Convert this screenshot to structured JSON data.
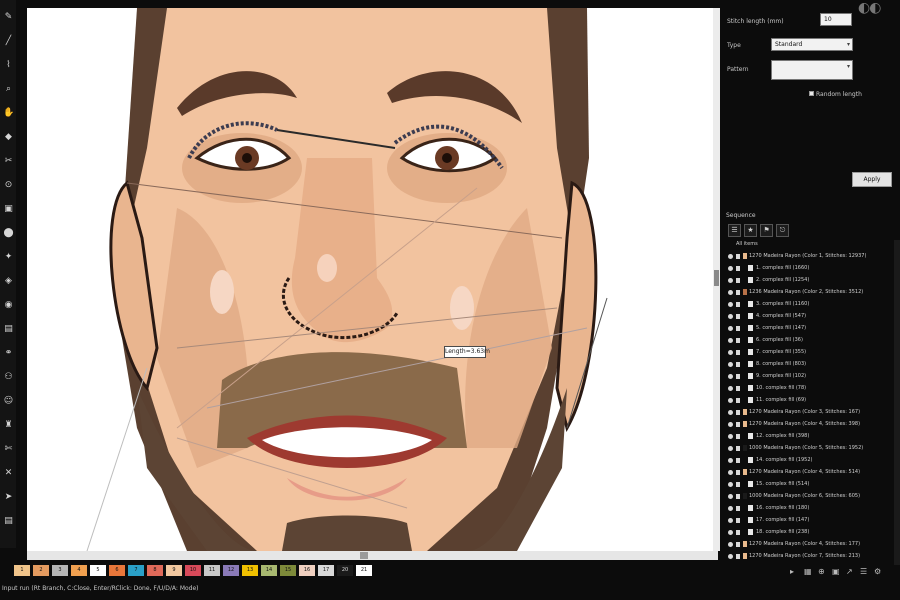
{
  "tools": [
    "pen-tool",
    "line-tool",
    "zigzag-tool",
    "zoom-tool",
    "hand-tool",
    "fill-tool",
    "knife-tool",
    "node-tool",
    "stamp-tool",
    "drop-tool",
    "pin-tool",
    "gauge-tool",
    "eye-tool",
    "grid-tool",
    "link-tool",
    "figure-tool",
    "person-tool",
    "lamp-tool",
    "cut-tool",
    "cross-tool",
    "arrow-tool",
    "file-tool"
  ],
  "canvas": {
    "tooltip": "Length=3.63m"
  },
  "stitch_panel": {
    "stitch_length_label": "Stitch length (mm)",
    "stitch_length_value": "10",
    "type_label": "Type",
    "type_value": "Standard",
    "pattern_label": "Pattern",
    "pattern_value": "",
    "random_length_label": "Random length",
    "apply_label": "Apply"
  },
  "sequence": {
    "header": "Sequence",
    "tabs": [
      "☰",
      "★",
      "⚑",
      "⎋"
    ],
    "rows": [
      {
        "text": "All items",
        "level": 0,
        "color": ""
      },
      {
        "text": "1270 Madeira Rayon (Color 1, Stitches: 12937)",
        "level": 1,
        "color": "#e8b98c"
      },
      {
        "text": "1. complex fill (1660)",
        "level": 2,
        "color": ""
      },
      {
        "text": "2. complex fill (1254)",
        "level": 2,
        "color": ""
      },
      {
        "text": "1236 Madeira Rayon (Color 2, Stitches: 3512)",
        "level": 1,
        "color": "#b87248"
      },
      {
        "text": "3. complex fill (1160)",
        "level": 2,
        "color": ""
      },
      {
        "text": "4. complex fill (547)",
        "level": 2,
        "color": ""
      },
      {
        "text": "5. complex fill (147)",
        "level": 2,
        "color": ""
      },
      {
        "text": "6. complex fill (36)",
        "level": 2,
        "color": ""
      },
      {
        "text": "7. complex fill (355)",
        "level": 2,
        "color": ""
      },
      {
        "text": "8. complex fill (803)",
        "level": 2,
        "color": ""
      },
      {
        "text": "9. complex fill (102)",
        "level": 2,
        "color": ""
      },
      {
        "text": "10. complex fill (78)",
        "level": 2,
        "color": ""
      },
      {
        "text": "11. complex fill (69)",
        "level": 2,
        "color": ""
      },
      {
        "text": "1270 Madeira Rayon (Color 3, Stitches: 167)",
        "level": 1,
        "color": "#e8b98c"
      },
      {
        "text": "1270 Madeira Rayon (Color 4, Stitches: 398)",
        "level": 1,
        "color": "#e8b98c"
      },
      {
        "text": "12. complex fill (398)",
        "level": 2,
        "color": ""
      },
      {
        "text": "1000 Madeira Rayon (Color 5, Stitches: 1952)",
        "level": 1,
        "color": "#1a1a1a"
      },
      {
        "text": "14. complex fill (1952)",
        "level": 2,
        "color": ""
      },
      {
        "text": "1270 Madeira Rayon (Color 4, Stitches: 514)",
        "level": 1,
        "color": "#e8b98c"
      },
      {
        "text": "15. complex fill (514)",
        "level": 2,
        "color": ""
      },
      {
        "text": "1000 Madeira Rayon (Color 6, Stitches: 605)",
        "level": 1,
        "color": "#1a1a1a"
      },
      {
        "text": "16. complex fill (180)",
        "level": 2,
        "color": ""
      },
      {
        "text": "17. complex fill (147)",
        "level": 2,
        "color": ""
      },
      {
        "text": "18. complex fill (238)",
        "level": 2,
        "color": ""
      },
      {
        "text": "1270 Madeira Rayon (Color 4, Stitches: 177)",
        "level": 1,
        "color": "#e8b98c"
      },
      {
        "text": "1270 Madeira Rayon (Color 7, Stitches: 213)",
        "level": 1,
        "color": "#e8b98c"
      }
    ]
  },
  "palette": {
    "chips": [
      {
        "label": "1",
        "color": "#f0c48a"
      },
      {
        "label": "2",
        "color": "#e39a5f"
      },
      {
        "label": "3",
        "color": "#b5b5b5"
      },
      {
        "label": "4",
        "color": "#f0a050"
      },
      {
        "label": "5",
        "color": "#ffffff"
      },
      {
        "label": "6",
        "color": "#e8763a"
      },
      {
        "label": "7",
        "color": "#2aa0c8"
      },
      {
        "label": "8",
        "color": "#e06a5a"
      },
      {
        "label": "9",
        "color": "#f2c8a0"
      },
      {
        "label": "10",
        "color": "#d84a5a"
      },
      {
        "label": "11",
        "color": "#c8c8c8"
      },
      {
        "label": "12",
        "color": "#8a7ab8"
      },
      {
        "label": "13",
        "color": "#f0c000"
      },
      {
        "label": "14",
        "color": "#a8b870"
      },
      {
        "label": "15",
        "color": "#7e8a3a"
      },
      {
        "label": "16",
        "color": "#f0d0c0"
      },
      {
        "label": "17",
        "color": "#d8d8d8"
      },
      {
        "label": "20",
        "color": "#1a1a1a"
      },
      {
        "label": "21",
        "color": "#ffffff"
      }
    ]
  },
  "status": "Input run (Rt Branch, C:Close, Enter/RClick: Done, F/U/D/A: Mode)"
}
